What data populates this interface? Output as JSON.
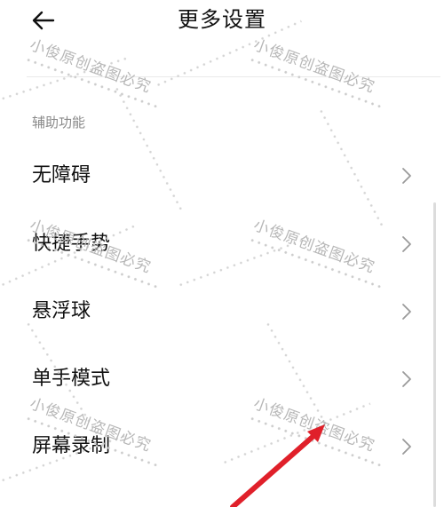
{
  "header": {
    "title": "更多设置",
    "back_icon": "back-arrow-icon"
  },
  "section": {
    "label": "辅助功能"
  },
  "menu": {
    "items": [
      {
        "label": "无障碍",
        "icon": "chevron-right-icon"
      },
      {
        "label": "快捷手势",
        "icon": "chevron-right-icon"
      },
      {
        "label": "悬浮球",
        "icon": "chevron-right-icon"
      },
      {
        "label": "单手模式",
        "icon": "chevron-right-icon"
      },
      {
        "label": "屏幕录制",
        "icon": "chevron-right-icon"
      }
    ]
  },
  "watermark": {
    "text": "小俊原创盗图必究"
  },
  "colors": {
    "text_primary": "#111111",
    "text_secondary": "#8a8a8a",
    "chevron": "#9a9a9a",
    "divider": "#eaeaea",
    "annotation_red": "#e0202a",
    "watermark": "#b7b7b7"
  }
}
